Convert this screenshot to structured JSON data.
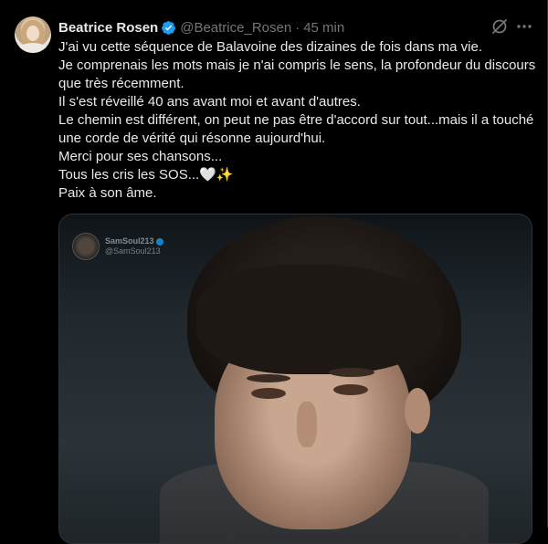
{
  "tweet": {
    "display_name": "Beatrice Rosen",
    "handle": "@Beatrice_Rosen",
    "separator": "·",
    "time": "45 min",
    "lines": [
      "J'ai vu cette séquence de Balavoine des dizaines de fois dans ma vie.",
      "Je comprenais les mots mais je n'ai compris le sens, la profondeur du discours que très récemment.",
      "Il s'est réveillé 40 ans avant moi et avant d'autres.",
      "Le chemin est différent, on peut ne pas être d'accord sur tout...mais il a touché une corde de vérité qui résonne aujourd'hui.",
      "Merci pour ses chansons...",
      "Tous les cris les SOS...🤍✨",
      "Paix à son âme."
    ]
  },
  "media": {
    "watermark_name": "SamSoul213",
    "watermark_handle": "@SamSoul213"
  },
  "colors": {
    "background": "#000000",
    "text": "#e7e9ea",
    "secondary": "#71767b",
    "verified": "#1d9bf0",
    "border": "#2f3336"
  },
  "icons": {
    "verified": "verified-badge-icon",
    "grok": "grok-icon",
    "more": "more-icon"
  }
}
